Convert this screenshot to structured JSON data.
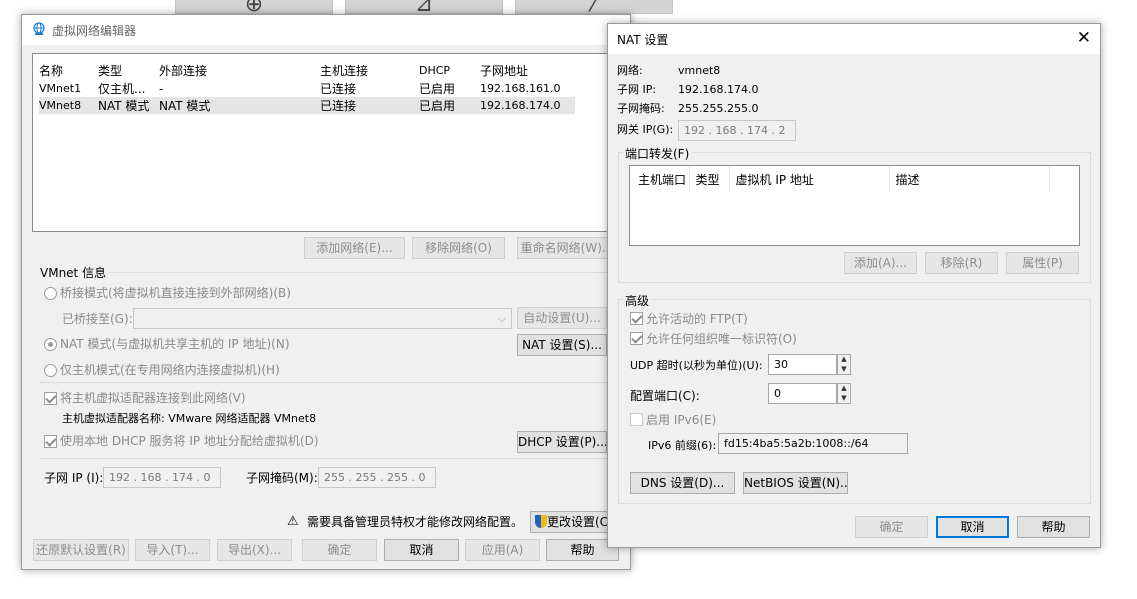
{
  "editor": {
    "title": "虚拟网络编辑器",
    "columns": [
      "名称",
      "类型",
      "外部连接",
      "主机连接",
      "DHCP",
      "子网地址"
    ],
    "rows": [
      [
        "VMnet1",
        "仅主机...",
        "-",
        "已连接",
        "已启用",
        "192.168.161.0"
      ],
      [
        "VMnet8",
        "NAT 模式",
        "NAT 模式",
        "已连接",
        "已启用",
        "192.168.174.0"
      ]
    ],
    "buttons": {
      "add": "添加网络(E)...",
      "remove": "移除网络(O)",
      "rename": "重命名网络(W)..."
    },
    "info_title": "VMnet 信息",
    "bridged": "桥接模式(将虚拟机直接连接到外部网络)(B)",
    "bridged_to": "已桥接至(G):",
    "auto_btn": "自动设置(U)...",
    "nat_mode": "NAT 模式(与虚拟机共享主机的 IP 地址)(N)",
    "nat_settings_btn": "NAT 设置(S)...",
    "host_only": "仅主机模式(在专用网络内连接虚拟机)(H)",
    "connect_adapter": "将主机虚拟适配器连接到此网络(V)",
    "adapter_name": "主机虚拟适配器名称: VMware 网络适配器 VMnet8",
    "use_dhcp": "使用本地 DHCP 服务将 IP 地址分配给虚拟机(D)",
    "dhcp_btn": "DHCP 设置(P)...",
    "subnet_ip_label": "子网 IP (I):",
    "subnet_ip": "192 . 168 . 174 .  0",
    "subnet_mask_label": "子网掩码(M):",
    "subnet_mask": "255 . 255 . 255 .  0",
    "admin_notice": "需要具备管理员特权才能修改网络配置。",
    "change_settings": "更改设置(C)",
    "bottom": {
      "restore": "还原默认设置(R)",
      "import": "导入(T)...",
      "export": "导出(X)...",
      "ok": "确定",
      "cancel": "取消",
      "apply": "应用(A)",
      "help": "帮助"
    }
  },
  "nat": {
    "title": "NAT 设置",
    "network_label": "网络:",
    "network": "vmnet8",
    "subnet_ip_label": "子网 IP:",
    "subnet_ip": "192.168.174.0",
    "subnet_mask_label": "子网掩码:",
    "subnet_mask": "255.255.255.0",
    "gateway_label": "网关 IP(G):",
    "gateway": "192 . 168 . 174 .  2",
    "port_forward_title": "端口转发(F)",
    "pf_columns": [
      "主机端口",
      "类型",
      "虚拟机 IP 地址",
      "描述"
    ],
    "pf_buttons": {
      "add": "添加(A)...",
      "remove": "移除(R)",
      "props": "属性(P)"
    },
    "advanced_title": "高级",
    "allow_ftp": "允许活动的 FTP(T)",
    "allow_oui": "允许任何组织唯一标识符(O)",
    "udp_label": "UDP 超时(以秒为单位)(U):",
    "udp_value": "30",
    "config_port_label": "配置端口(C):",
    "config_port_value": "0",
    "ipv6_enable": "启用 IPv6(E)",
    "ipv6_prefix_label": "IPv6 前缀(6):",
    "ipv6_prefix": "fd15:4ba5:5a2b:1008::/64",
    "dns_btn": "DNS 设置(D)...",
    "netbios_btn": "NetBIOS 设置(N)...",
    "ok": "确定",
    "cancel": "取消",
    "help": "帮助"
  }
}
